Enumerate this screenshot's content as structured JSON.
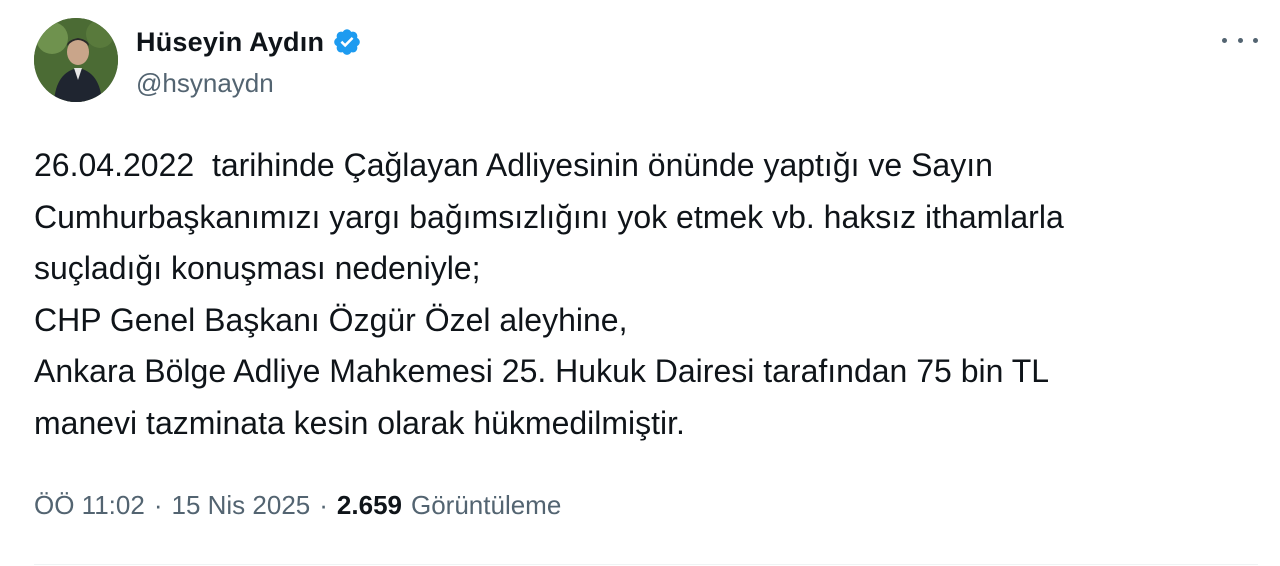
{
  "author": {
    "display_name": "Hüseyin Aydın",
    "handle": "@hsynaydn",
    "verified": true,
    "verified_icon": "verified-badge-icon",
    "verified_color": "#1d9bf0"
  },
  "more_icon": "more-horizontal-icon",
  "tweet": {
    "lines": [
      "26.04.2022  tarihinde Çağlayan Adliyesinin önünde yaptığı ve Sayın",
      "Cumhurbaşkanımızı yargı bağımsızlığını yok etmek vb. haksız ithamlarla",
      "suçladığı konuşması nedeniyle;",
      "CHP Genel Başkanı Özgür Özel aleyhine,",
      "Ankara Bölge Adliye Mahkemesi 25. Hukuk Dairesi tarafından 75 bin TL",
      "manevi tazminata kesin olarak hükmedilmiştir."
    ]
  },
  "meta": {
    "time": "ÖÖ 11:02",
    "separator": "·",
    "date": "15 Nis 2025",
    "views_count": "2.659",
    "views_label": "Görüntüleme"
  },
  "colors": {
    "text_primary": "#0f1419",
    "text_secondary": "#536471",
    "divider": "#eff3f4"
  }
}
